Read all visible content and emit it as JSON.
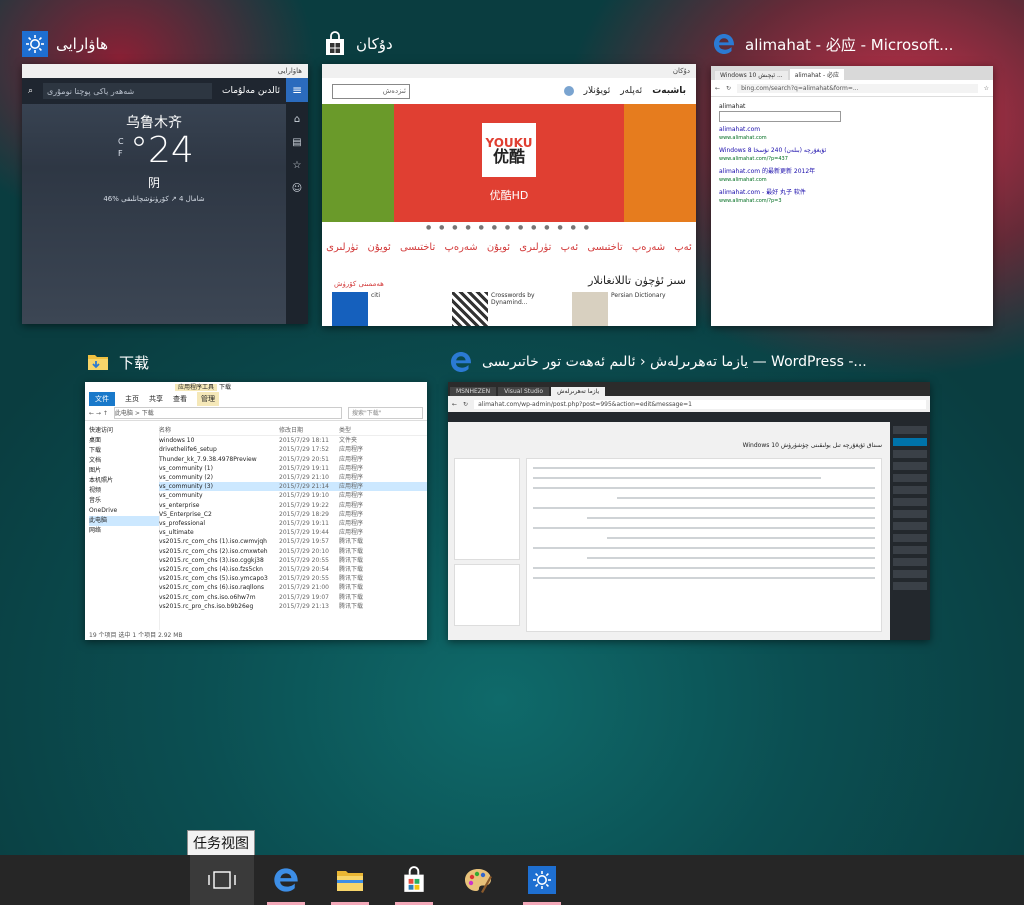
{
  "windows": {
    "weather": {
      "title": "ھاۋارايى",
      "icon": "weather-sun-icon",
      "chrome": "ھاۋارايى",
      "nav_title": "ئالدىن مەلۇمات",
      "search_placeholder": "شەھەر ياكى پوچتا نومۇرى",
      "city": "乌鲁木齐",
      "temp": "°24",
      "unit_c": "C",
      "unit_f": "F",
      "desc": "阴",
      "stats": "46%   شامال 4 ↗   كۆرۈنۈشچانلىقى"
    },
    "store": {
      "title": "دۇكان",
      "icon": "store-bag-icon",
      "chrome": "دۇكان",
      "nav": [
        "باشبەت",
        "ئەپلەر",
        "ئويۇنلار"
      ],
      "search_placeholder": "ئىزدەش",
      "youku_top": "YOUKU",
      "youku_bottom": "优酷",
      "banner_label": "优酷HD",
      "dots": "● ● ● ● ● ● ● ● ● ● ● ● ●",
      "links": "ئەپ شەرەپ تاختىسى   ئەپ تۈرلىرى   ئويۇن شەرەپ تاختىسى   ئويۇن تۈرلىرى",
      "section": "سىز ئۈچۈن تاللانغانلار",
      "more": "ھەممىنى كۆرۈش",
      "tiles": [
        "Persian Dictionary",
        "Crosswords by Dynamind...",
        "citi"
      ]
    },
    "edge": {
      "title": "alimahat - 必应 - Microsoft...",
      "icon": "edge-icon",
      "tabs": [
        "Windows 10 ئېچىش ...",
        "alimahat - 必应"
      ],
      "url": "bing.com/search?q=alimahat&form=...",
      "query": "alimahat",
      "results": [
        {
          "title": "alimahat.com",
          "url": "www.alimahat.com"
        },
        {
          "title": "Windows 8 ئۇيغۇرچە (بىلەن) 240 نۇسخا",
          "url": "www.alimahat.com/?p=437"
        },
        {
          "title": "alimahat.com 的最新更新 2012年",
          "url": "www.alimahat.com"
        },
        {
          "title": "alimahat.com - 最好 丸子 软件",
          "url": "www.alimahat.com/?p=3"
        }
      ]
    },
    "explorer": {
      "title": "下载",
      "icon": "folder-icon",
      "tool_tab": "应用程序工具",
      "ribbon": [
        "文件",
        "主页",
        "共享",
        "查看",
        "管理"
      ],
      "path": "此电脑 > 下载",
      "search_placeholder": "搜索\"下载\"",
      "nav": [
        "快速访问",
        "桌面",
        "下载",
        "文档",
        "图片",
        "本机照片",
        "视频",
        "音乐",
        "OneDrive",
        "此电脑",
        "网络"
      ],
      "columns": [
        "名称",
        "修改日期",
        "类型"
      ],
      "files": [
        [
          "windows 10",
          "2015/7/29 18:11",
          "文件夹"
        ],
        [
          "drivethelife6_setup",
          "2015/7/29 17:52",
          "应用程序"
        ],
        [
          "Thunder_kk_7.9.38.4978Preview",
          "2015/7/29 20:51",
          "应用程序"
        ],
        [
          "vs_community (1)",
          "2015/7/29 19:11",
          "应用程序"
        ],
        [
          "vs_community (2)",
          "2015/7/29 21:10",
          "应用程序"
        ],
        [
          "vs_community (3)",
          "2015/7/29 21:14",
          "应用程序"
        ],
        [
          "vs_community",
          "2015/7/29 19:10",
          "应用程序"
        ],
        [
          "vs_enterprise",
          "2015/7/29 19:22",
          "应用程序"
        ],
        [
          "VS_Enterprise_C2",
          "2015/7/29 18:29",
          "应用程序"
        ],
        [
          "vs_professional",
          "2015/7/29 19:11",
          "应用程序"
        ],
        [
          "vs_ultimate",
          "2015/7/29 19:44",
          "应用程序"
        ],
        [
          "vs2015.rc_com_chs (1).iso.cwmvjqh",
          "2015/7/29 19:57",
          "腾讯下载"
        ],
        [
          "vs2015.rc_com_chs (2).iso.cmxwteh",
          "2015/7/29 20:10",
          "腾讯下载"
        ],
        [
          "vs2015.rc_com_chs (3).iso.cggkj38",
          "2015/7/29 20:55",
          "腾讯下载"
        ],
        [
          "vs2015.rc_com_chs (4).iso.fzs5ckn",
          "2015/7/29 20:54",
          "腾讯下载"
        ],
        [
          "vs2015.rc_com_chs (5).iso.ymcapo3",
          "2015/7/29 20:55",
          "腾讯下载"
        ],
        [
          "vs2015.rc_com_chs (6).iso.raqllons",
          "2015/7/29 21:00",
          "腾讯下载"
        ],
        [
          "vs2015.rc_com_chs.iso.o6hw7m",
          "2015/7/29 19:07",
          "腾讯下载"
        ],
        [
          "vs2015.rc_pro_chs.iso.b9b26eg",
          "2015/7/29 21:13",
          "腾讯下载"
        ]
      ],
      "status": "19 个项目   选中 1 个项目 2.92 MB"
    },
    "wordpress": {
      "title": "يازما تەھرىرلەش ‹ ئالىم ئەھەت تور خاتىرىسى — WordPress -...",
      "icon": "edge-icon",
      "tabs": [
        "MSNHEZEN",
        "Visual Studio",
        "يازما تەھرىرلەش"
      ],
      "url": "alimahat.com/wp-admin/post.php?post=995&action=edit&message=1",
      "post_title": "Windows 10 سىناق ئۇيغۇرچە تىل بولىقىنى چۈشۈرۈش"
    }
  },
  "taskbar": {
    "tooltip": "任务视图",
    "buttons": [
      "task-view",
      "edge",
      "explorer",
      "store",
      "paint",
      "weather"
    ]
  }
}
